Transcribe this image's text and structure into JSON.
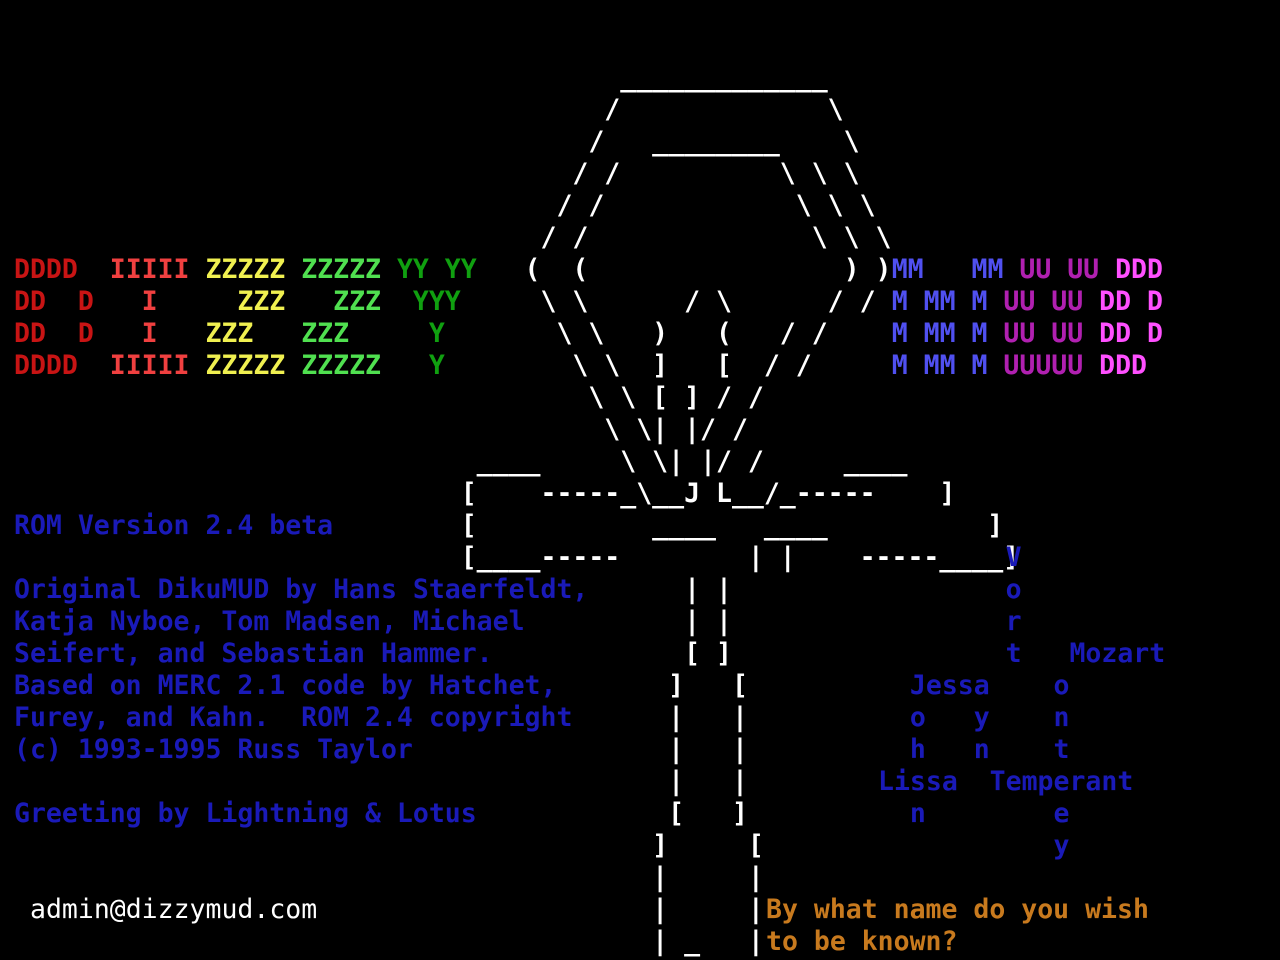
{
  "ankh_art": [
    "                                      _____________",
    "                                     /             \\",
    "                                    /   ________    \\",
    "                                   / /          \\ \\ \\",
    "                                  / /            \\ \\ \\",
    "                                 / /              \\ \\ \\",
    "                                (  (                ) )",
    "                                 \\ \\      / \\      / /",
    "                                  \\ \\   )   (   / /",
    "                                   \\ \\  ]   [  / /",
    "                                    \\ \\ [ ] / /",
    "                                     \\ \\| |/ /",
    "                             ____     \\ \\| |/ /     ____",
    "                            [    -----_\\__J L__/_-----    ]",
    "                            [           ____   ____          ]",
    "                            [____-----        | |    -----____]",
    "                                          | |",
    "                                          | |",
    "                                          [ ]",
    "                                         ]   [",
    "                                         |   |",
    "                                         |   |",
    "                                         |   |",
    "                                         [   ]",
    "                                        ]     [",
    "                                        |     |",
    "                                        |     |",
    "                                        | _   |",
    "                                        [,'  ',]"
  ],
  "logo": {
    "rows": [
      {
        "d": "DDDD  ",
        "i": "IIIII ",
        "z1": "ZZZZZ ",
        "z2": "ZZZZZ ",
        "y": "YY YY",
        "m": "MM   MM ",
        "u": "UU UU ",
        "dd": "DDD"
      },
      {
        "d": "DD  D ",
        "i": "  I   ",
        "z1": "  ZZZ ",
        "z2": "  ZZZ ",
        "y": " YYY ",
        "m": "M MM M ",
        "u": "UU UU ",
        "dd": "DD D"
      },
      {
        "d": "DD  D ",
        "i": "  I   ",
        "z1": "ZZZ   ",
        "z2": "ZZZ   ",
        "y": "  Y  ",
        "m": "M MM M ",
        "u": "UU UU ",
        "dd": "DD D"
      },
      {
        "d": "DDDD  ",
        "i": "IIIII ",
        "z1": "ZZZZZ ",
        "z2": "ZZZZZ ",
        "y": "  Y  ",
        "m": "M MM M ",
        "u": "UUUUU ",
        "dd": "DDD"
      }
    ]
  },
  "credits": {
    "version": "ROM Version 2.4 beta",
    "line1": "Original DikuMUD by Hans Staerfeldt,",
    "line2": "Katja Nyboe, Tom Madsen, Michael",
    "line3": "Seifert, and Sebastian Hammer.",
    "line4": "Based on MERC 2.1 code by Hatchet,",
    "line5": "Furey, and Kahn.  ROM 2.4 copyright",
    "line6": "(c) 1993-1995 Russ Taylor",
    "greeting": "Greeting by Lightning & Lotus"
  },
  "names_art": [
    "        V",
    "        o",
    "        r",
    "        t   Mozart",
    "  Jessa    o",
    "  o   y    n",
    "  h   n    t",
    "Lissa  Temperant",
    "  n        e",
    "           y"
  ],
  "admin_email": "admin@dizzymud.com",
  "prompt": {
    "line1": "By what name do you wish",
    "line2": "to be known?"
  }
}
